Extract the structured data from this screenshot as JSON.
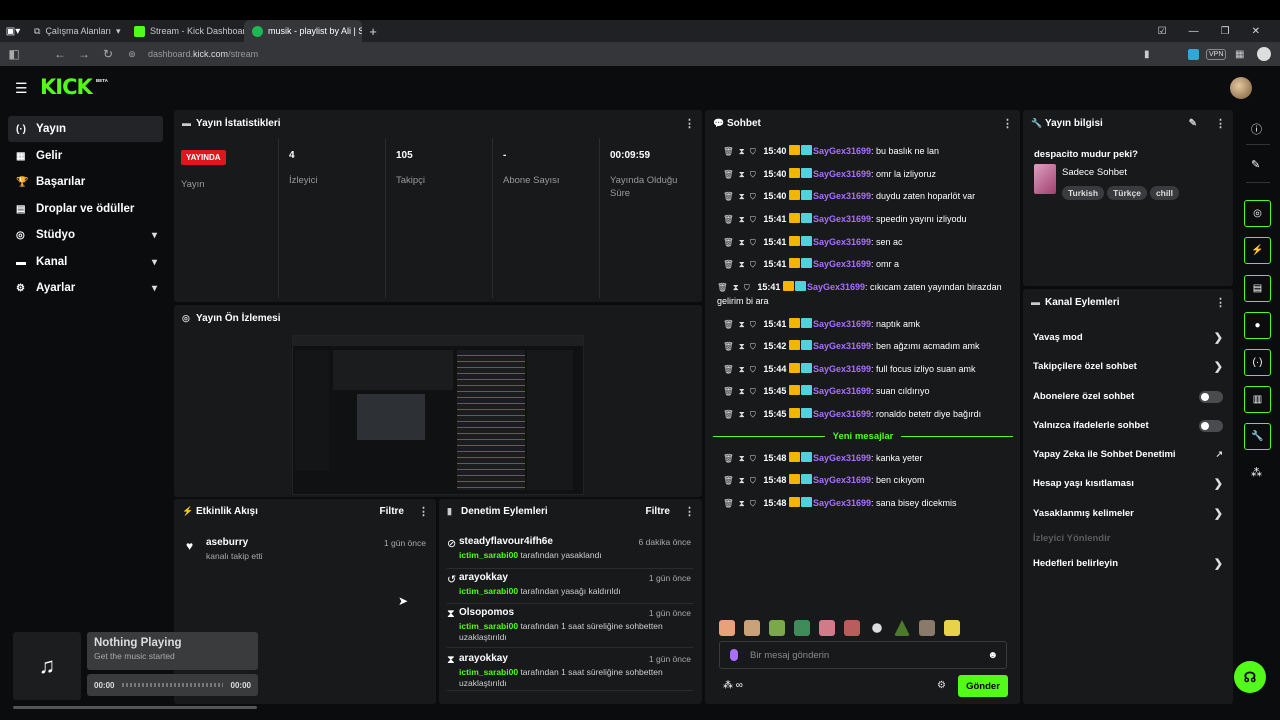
{
  "browser": {
    "workspaces": "Çalışma Alanları",
    "tabs": [
      {
        "label": "Stream - Kick Dashboard",
        "color": "#53fc18"
      },
      {
        "label": "musik - playlist by Ali | Spo",
        "color": "#1db954"
      }
    ],
    "new_tab": "+",
    "url_prefix": "dashboard.",
    "url_domain": "kick.com",
    "url_path": "/stream",
    "vpn": "VPN"
  },
  "brand": {
    "logo": "KICK",
    "beta": "BETA",
    "accent": "#53fc18"
  },
  "sidebar": {
    "items": [
      {
        "label": "Yayın",
        "icon": "broadcast-icon",
        "glyph": "(·)"
      },
      {
        "label": "Gelir",
        "icon": "revenue-icon",
        "glyph": "▦"
      },
      {
        "label": "Başarılar",
        "icon": "trophy-icon",
        "glyph": "🏆"
      },
      {
        "label": "Droplar ve ödüller",
        "icon": "gift-icon",
        "glyph": "▤"
      },
      {
        "label": "Stüdyo",
        "icon": "studio-icon",
        "glyph": "◎"
      },
      {
        "label": "Kanal",
        "icon": "channel-icon",
        "glyph": "▬"
      },
      {
        "label": "Ayarlar",
        "icon": "gear-icon",
        "glyph": "⚙"
      }
    ]
  },
  "stats": {
    "title": "Yayın İstatistikleri",
    "live_badge": "YAYINDA",
    "items": [
      {
        "value": "",
        "label": "Yayın"
      },
      {
        "value": "4",
        "label": "İzleyici"
      },
      {
        "value": "105",
        "label": "Takipçi"
      },
      {
        "value": "-",
        "label": "Abone Sayısı"
      },
      {
        "value": "00:09:59",
        "label": "Yayında Olduğu Süre"
      }
    ]
  },
  "preview": {
    "title": "Yayın Ön İzlemesi"
  },
  "activity": {
    "title": "Etkinlik Akışı",
    "filter": "Filtre",
    "items": [
      {
        "user": "aseburry",
        "desc": "kanalı takip etti",
        "time": "1 gün önce"
      }
    ]
  },
  "moderation": {
    "title": "Denetim Eylemleri",
    "filter": "Filtre",
    "items": [
      {
        "user": "steadyflavour4ifh6e",
        "actor": "ictim_sarabi00",
        "desc": " tarafından yasaklandı",
        "time": "6 dakika önce",
        "icon": "ban-icon",
        "glyph": "⊘"
      },
      {
        "user": "arayokkay",
        "actor": "ictim_sarabi00",
        "desc": " tarafından yasağı kaldırıldı",
        "time": "1 gün önce",
        "icon": "undo-icon",
        "glyph": "↺"
      },
      {
        "user": "Olsopomos",
        "actor": "ictim_sarabi00",
        "desc": " tarafından 1 saat süreliğine sohbetten uzaklaştırıldı",
        "time": "1 gün önce",
        "icon": "hourglass-icon",
        "glyph": "⧗"
      },
      {
        "user": "arayokkay",
        "actor": "ictim_sarabi00",
        "desc": " tarafından 1 saat süreliğine sohbetten uzaklaştırıldı",
        "time": "1 gün önce",
        "icon": "hourglass-icon",
        "glyph": "⧗"
      }
    ]
  },
  "chat": {
    "title": "Sohbet",
    "tools": "🗑⧗⛉",
    "new_messages": "Yeni mesajlar",
    "messages": [
      {
        "time": "15:40",
        "user": "SayGex31699",
        "text": ": bu baslık ne lan"
      },
      {
        "time": "15:40",
        "user": "SayGex31699",
        "text": ": omr la izliyoruz"
      },
      {
        "time": "15:40",
        "user": "SayGex31699",
        "text": ": duydu zaten hoparlöt var"
      },
      {
        "time": "15:41",
        "user": "SayGex31699",
        "text": ": speedin yayını izliyodu"
      },
      {
        "time": "15:41",
        "user": "SayGex31699",
        "text": ": sen ac"
      },
      {
        "time": "15:41",
        "user": "SayGex31699",
        "text": ": omr a"
      },
      {
        "time": "15:41",
        "user": "SayGex31699",
        "text": ": cıkıcam zaten yayından birazdan gelirim bi ara"
      },
      {
        "time": "15:41",
        "user": "SayGex31699",
        "text": ": naptık amk"
      },
      {
        "time": "15:42",
        "user": "SayGex31699",
        "text": ": ben ağzımı acmadım amk"
      },
      {
        "time": "15:44",
        "user": "SayGex31699",
        "text": ": full focus izliyo suan amk"
      },
      {
        "time": "15:45",
        "user": "SayGex31699",
        "text": ": suan cıldırıyo"
      },
      {
        "time": "15:45",
        "user": "SayGex31699",
        "text": ": ronaldo betetr diye bağırdı"
      },
      {
        "time": "15:48",
        "user": "SayGex31699",
        "text": ": kanka yeter"
      },
      {
        "time": "15:48",
        "user": "SayGex31699",
        "text": ": ben cıkıyom"
      },
      {
        "time": "15:48",
        "user": "SayGex31699",
        "text": ": sana bisey dicekmis"
      }
    ],
    "input_placeholder": "Bir mesaj gönderin",
    "send": "Gönder"
  },
  "stream_info": {
    "title": "Yayın bilgisi",
    "stream_title": "despacito mudur peki?",
    "category": "Sadece Sohbet",
    "tags": [
      "Turkish",
      "Türkçe",
      "chill"
    ]
  },
  "channel_actions": {
    "title": "Kanal Eylemleri",
    "items": [
      {
        "label": "Yavaş mod",
        "kind": "chevron"
      },
      {
        "label": "Takipçilere özel sohbet",
        "kind": "chevron"
      },
      {
        "label": "Abonelere özel sohbet",
        "kind": "toggle"
      },
      {
        "label": "Yalnızca ifadelerle sohbet",
        "kind": "toggle"
      },
      {
        "label": "Yapay Zeka ile Sohbet Denetimi",
        "kind": "external"
      },
      {
        "label": "Hesap yaşı kısıtlaması",
        "kind": "chevron"
      },
      {
        "label": "Yasaklanmış kelimeler",
        "kind": "chevron"
      },
      {
        "label": "İzleyici Yönlendir",
        "kind": "disabled"
      },
      {
        "label": "Hedefleri belirleyin",
        "kind": "chevron"
      }
    ]
  },
  "music": {
    "title": "Nothing Playing",
    "subtitle": "Get the music started",
    "elapsed": "00:00",
    "total": "00:00"
  }
}
